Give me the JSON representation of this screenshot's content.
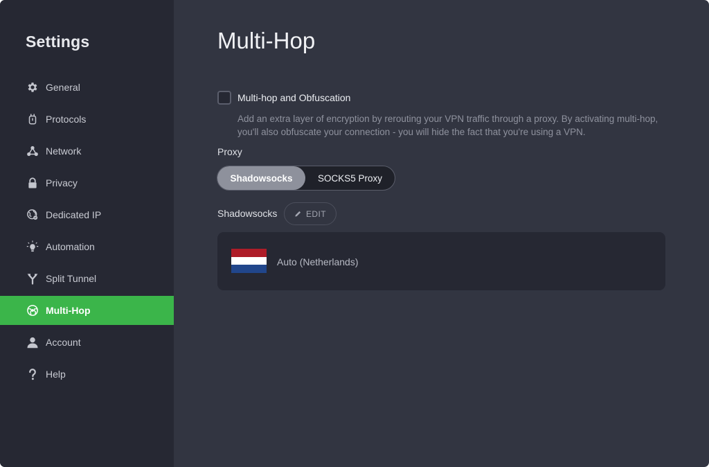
{
  "sidebar": {
    "title": "Settings",
    "items": [
      {
        "label": "General",
        "icon": "gear-icon",
        "active": false
      },
      {
        "label": "Protocols",
        "icon": "protocols-icon",
        "active": false
      },
      {
        "label": "Network",
        "icon": "network-icon",
        "active": false
      },
      {
        "label": "Privacy",
        "icon": "lock-icon",
        "active": false
      },
      {
        "label": "Dedicated IP",
        "icon": "dedicated-ip-icon",
        "active": false
      },
      {
        "label": "Automation",
        "icon": "lightbulb-icon",
        "active": false
      },
      {
        "label": "Split Tunnel",
        "icon": "split-tunnel-icon",
        "active": false
      },
      {
        "label": "Multi-Hop",
        "icon": "globe-icon",
        "active": true
      },
      {
        "label": "Account",
        "icon": "user-icon",
        "active": false
      },
      {
        "label": "Help",
        "icon": "question-icon",
        "active": false
      }
    ]
  },
  "main": {
    "title": "Multi-Hop",
    "multihop": {
      "checkbox_label": "Multi-hop and Obfuscation",
      "checked": false,
      "description": "Add an extra layer of encryption by rerouting your VPN traffic through a proxy. By activating multi-hop, you'll also obfuscate your connection - you will hide the fact that you're using a VPN."
    },
    "proxy": {
      "label": "Proxy",
      "options": [
        "Shadowsocks",
        "SOCKS5 Proxy"
      ],
      "selected": "Shadowsocks"
    },
    "shadowsocks": {
      "label": "Shadowsocks",
      "edit_label": "EDIT"
    },
    "server": {
      "name": "Auto (Netherlands)",
      "flag_icon": "netherlands-flag-icon",
      "flag_colors": [
        "#ae1c28",
        "#ffffff",
        "#21468b"
      ]
    }
  },
  "colors": {
    "accent": "#3bb54a",
    "sidebar_bg": "#262833",
    "main_bg": "#323541"
  }
}
